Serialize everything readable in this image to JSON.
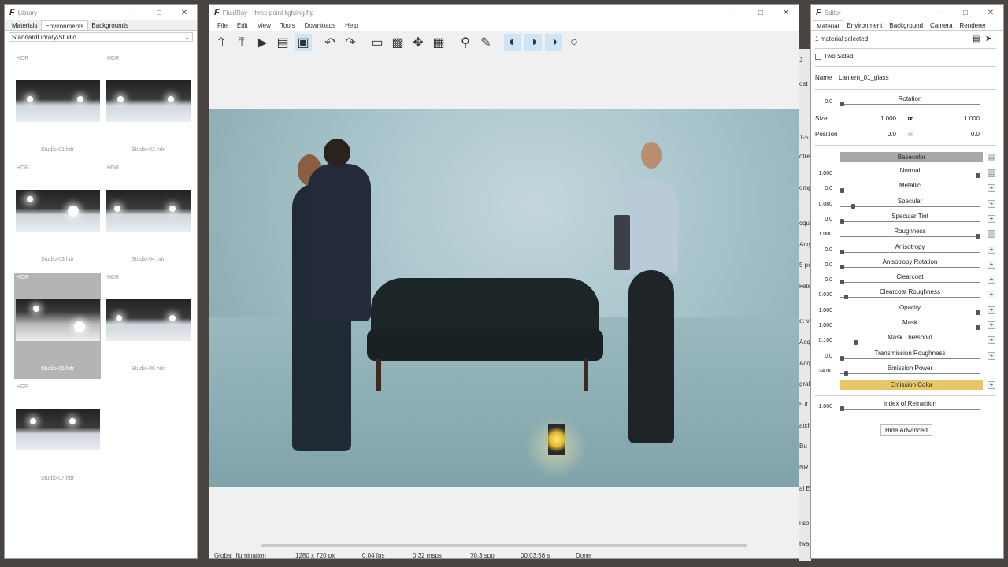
{
  "library": {
    "title": "Library",
    "tabs": [
      "Materials",
      "Environments",
      "Backgrounds"
    ],
    "active_tab": "Environments",
    "path": "StandardLibrary\\Studio",
    "items": [
      {
        "badge": "HDR",
        "name": "Studio-01.hdr"
      },
      {
        "badge": "HDR",
        "name": "Studio-02.hdr"
      },
      {
        "badge": "HDR",
        "name": "Studio-03.hdr"
      },
      {
        "badge": "HDR",
        "name": "Studio-04.hdr"
      },
      {
        "badge": "HDR",
        "name": "Studio-05.hdr"
      },
      {
        "badge": "HDR",
        "name": "Studio-06.hdr"
      },
      {
        "badge": "HDR",
        "name": "Studio-07.hdr"
      }
    ],
    "selected": "Studio-05.hdr"
  },
  "viewport": {
    "title": "FluidRay - three point lighting.frp",
    "menu": [
      "File",
      "Edit",
      "View",
      "Tools",
      "Downloads",
      "Help"
    ],
    "status": {
      "mode": "Global Illumination",
      "resolution": "1280 x 720 px",
      "fps": "0.04 fps",
      "msps": "0.32 msps",
      "spp": "70.3 spp",
      "time": "00:03:56 s",
      "state": "Done"
    }
  },
  "behind": {
    "snippets": [
      "J",
      "ost",
      "1-5",
      "otre",
      "omp",
      "cqu",
      "Acq",
      "5 pe",
      "kete",
      "e: vi",
      "Acq",
      "Acq",
      "gral",
      "5 it",
      "atch",
      "Bu",
      "NR",
      "al E",
      "l so",
      "tware"
    ]
  },
  "editor": {
    "title": "Editor",
    "tabs": [
      "Material",
      "Environment",
      "Background",
      "Camera",
      "Renderer"
    ],
    "active_tab": "Material",
    "selection_info": "1 material selected",
    "two_sided_label": "Two Sided",
    "name_label": "Name",
    "name_value": "Lantern_01_glass",
    "rotation": {
      "label": "Rotation",
      "value": "0.0"
    },
    "size": {
      "label": "Size",
      "x": "1.000",
      "y": "1.000"
    },
    "position": {
      "label": "Position",
      "x": "0.0",
      "y": "0.0"
    },
    "basecolor_label": "Basecolor",
    "properties": [
      {
        "label": "Normal",
        "value": "1.000",
        "level": 1.0,
        "action": "..."
      },
      {
        "label": "Metallic",
        "value": "0.0",
        "level": 0.0,
        "action": "+"
      },
      {
        "label": "Specular",
        "value": "0.080",
        "level": 0.08,
        "action": "+"
      },
      {
        "label": "Specular Tint",
        "value": "0.0",
        "level": 0.0,
        "action": "+"
      },
      {
        "label": "Roughness",
        "value": "1.000",
        "level": 1.0,
        "action": "..."
      },
      {
        "label": "Anisotropy",
        "value": "0.0",
        "level": 0.0,
        "action": "+"
      },
      {
        "label": "Anisotropy Rotation",
        "value": "0.0",
        "level": 0.0,
        "action": "+"
      },
      {
        "label": "Clearcoat",
        "value": "0.0",
        "level": 0.0,
        "action": "+"
      },
      {
        "label": "Clearcoat Roughness",
        "value": "0.030",
        "level": 0.03,
        "action": "+"
      },
      {
        "label": "Opacity",
        "value": "1.000",
        "level": 1.0,
        "action": "+"
      },
      {
        "label": "Mask",
        "value": "1.000",
        "level": 1.0,
        "action": "+"
      },
      {
        "label": "Mask Threshold",
        "value": "0.100",
        "level": 0.1,
        "action": "+"
      },
      {
        "label": "Transmission Roughness",
        "value": "0.0",
        "level": 0.0,
        "action": "+"
      },
      {
        "label": "Emission Power",
        "value": "34.00",
        "level": 0.03,
        "action": ""
      }
    ],
    "emission_color_label": "Emission Color",
    "emission_color": "#e8c76a",
    "ior": {
      "label": "Index of Refraction",
      "value": "1.000",
      "level": 0.0
    },
    "hide_advanced": "Hide Advanced"
  }
}
